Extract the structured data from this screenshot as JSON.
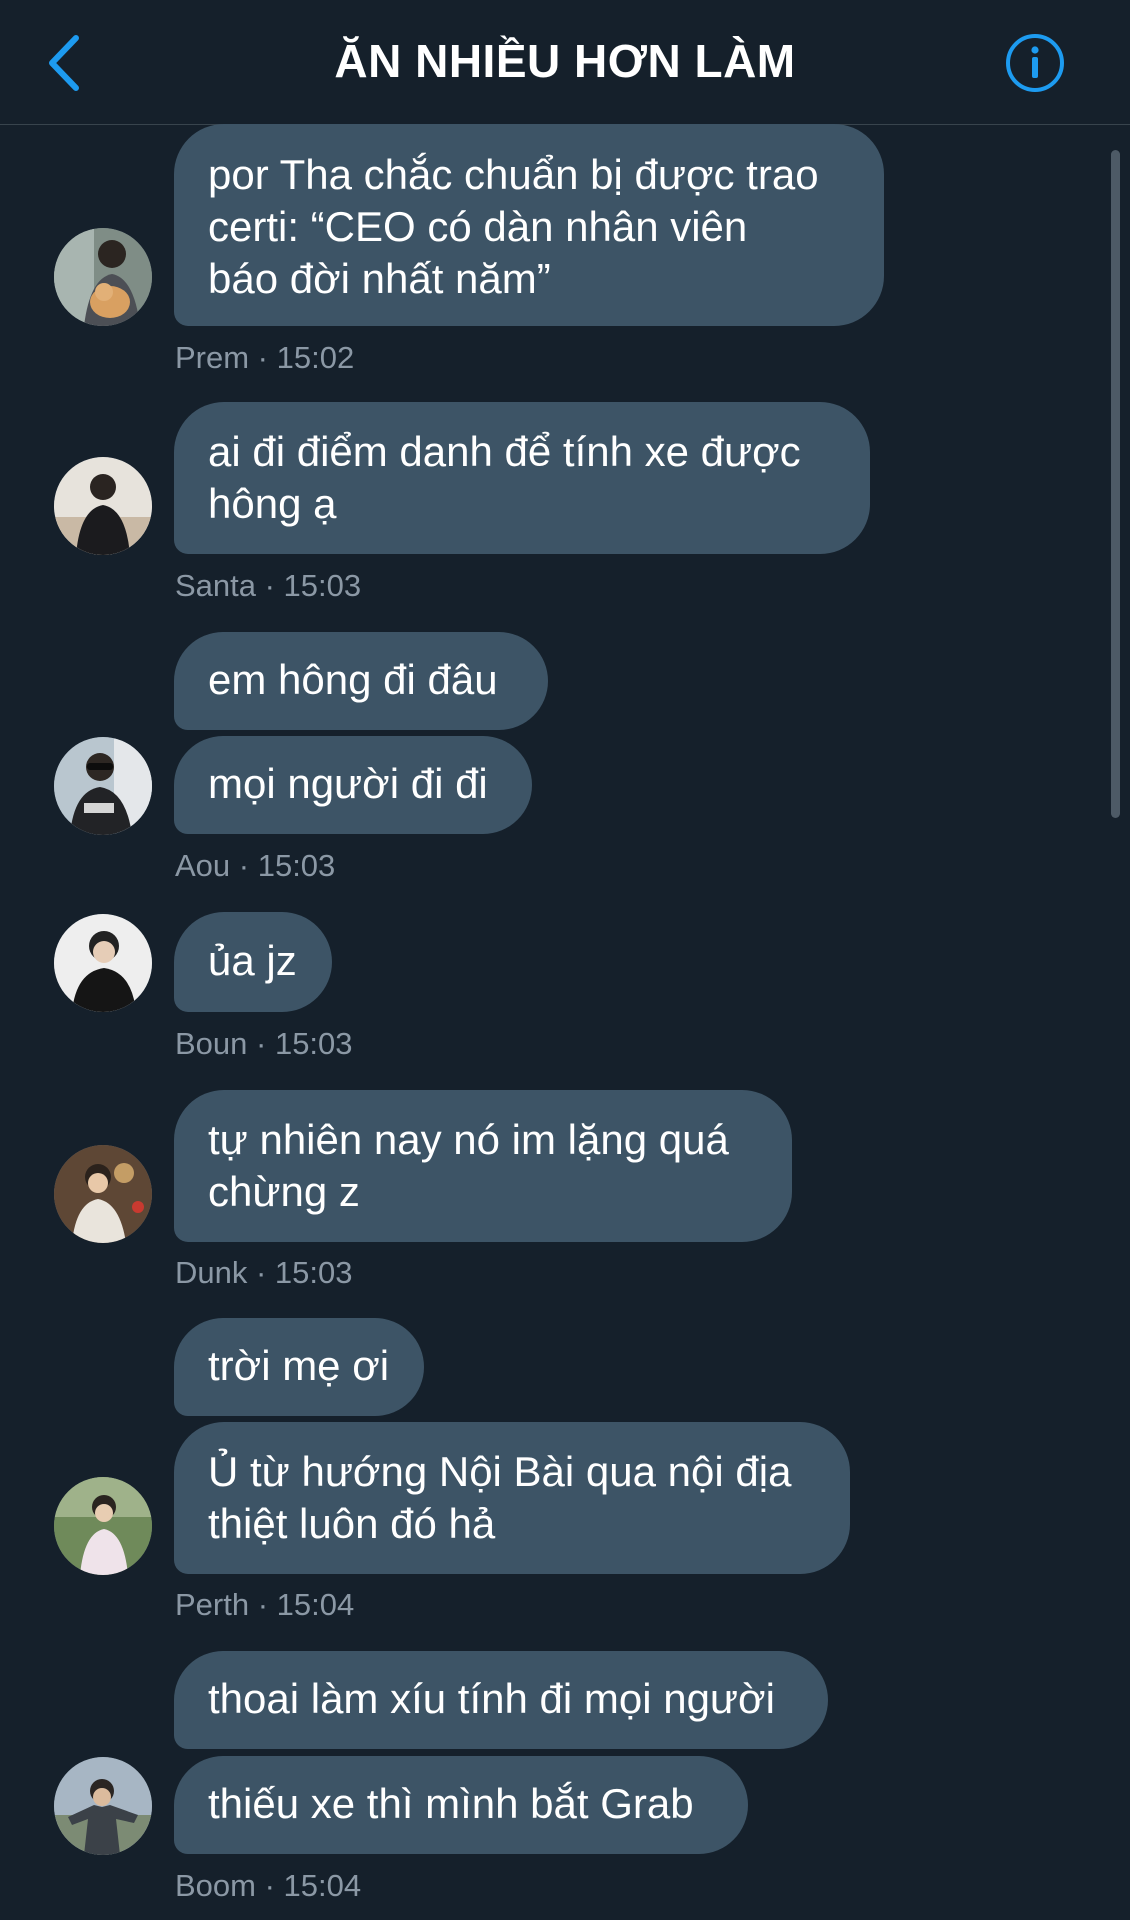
{
  "header": {
    "title": "ĂN NHIỀU HƠN LÀM"
  },
  "colors": {
    "background": "#15202b",
    "bubble": "#3d5466",
    "accent": "#1d9bf0",
    "meta": "#8b98a5"
  },
  "icons": {
    "back": "chevron-left-icon",
    "info": "info-icon"
  },
  "messages": [
    {
      "lines": [
        "por Tha chắc chuẩn bị được trao",
        "certi: “CEO có dàn nhân viên",
        "báo đời nhất năm”"
      ]
    },
    {
      "lines": [
        "ai đi điểm danh để tính xe được",
        "hông ạ"
      ]
    },
    {
      "lines": [
        "em hông đi đâu"
      ]
    },
    {
      "lines": [
        "mọi người đi đi"
      ]
    },
    {
      "lines": [
        "ủa jz"
      ]
    },
    {
      "lines": [
        "tự nhiên nay nó im lặng quá",
        "chừng z"
      ]
    },
    {
      "lines": [
        "trời mẹ ơi"
      ]
    },
    {
      "lines": [
        "Ủ từ hướng Nội Bài qua nội địa",
        "thiệt luôn đó hả"
      ]
    },
    {
      "lines": [
        "thoai làm xíu tính đi mọi người"
      ]
    },
    {
      "lines": [
        "thiếu xe thì mình bắt Grab"
      ]
    }
  ],
  "meta": [
    "Prem · 15:02",
    "Santa · 15:03",
    "Aou · 15:03",
    "Boun · 15:03",
    "Dunk · 15:03",
    "Perth · 15:04",
    "Boom · 15:04"
  ]
}
